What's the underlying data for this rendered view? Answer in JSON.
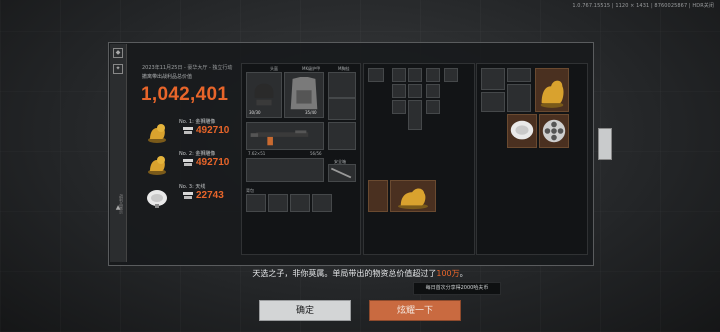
{
  "version_text": "1.0.767.15515 | 1120 × 1431 | 8760025867 | HDR关闭",
  "date_text": "2023年11月25日 - 豪华大厅 - 独立行动",
  "subtitle": "撤离带出战利品总价值",
  "total_value": "1,042,401",
  "ranks": [
    {
      "label": "No. 1: 金狮雕像",
      "amount": "492710",
      "icon": "gold-lion-statue"
    },
    {
      "label": "No. 2: 金狮雕像",
      "amount": "492710",
      "icon": "gold-lion-statue"
    },
    {
      "label": "No. 3: 天线",
      "amount": "22743",
      "icon": "satellite-dish"
    }
  ],
  "rail_text": "战利品展示",
  "gear": {
    "helmet": "头盔",
    "armor": "MK级护甲",
    "rig": "M胸挂",
    "helmet_durability": "30/30",
    "armor_durability": "35/40",
    "weapon_name": "P.AL",
    "weapon_stat_left": "7.62×51",
    "weapon_stat_right": "56/56",
    "melee": "刀具",
    "backpack": "背包",
    "pistol_label": "手枪",
    "secure_label": "安全箱"
  },
  "buttons": {
    "confirm": "确定",
    "share": "炫耀一下"
  },
  "message": {
    "pre": "天选之子，非你莫属。单局带出的物资总价值超过了",
    "highlight": "100万",
    "post": "。"
  },
  "tooltip": "每日首次分享得2000哈夫币",
  "colors": {
    "accent": "#e8652a",
    "button_confirm": "#d3d5d6",
    "button_share": "#c96a40"
  }
}
